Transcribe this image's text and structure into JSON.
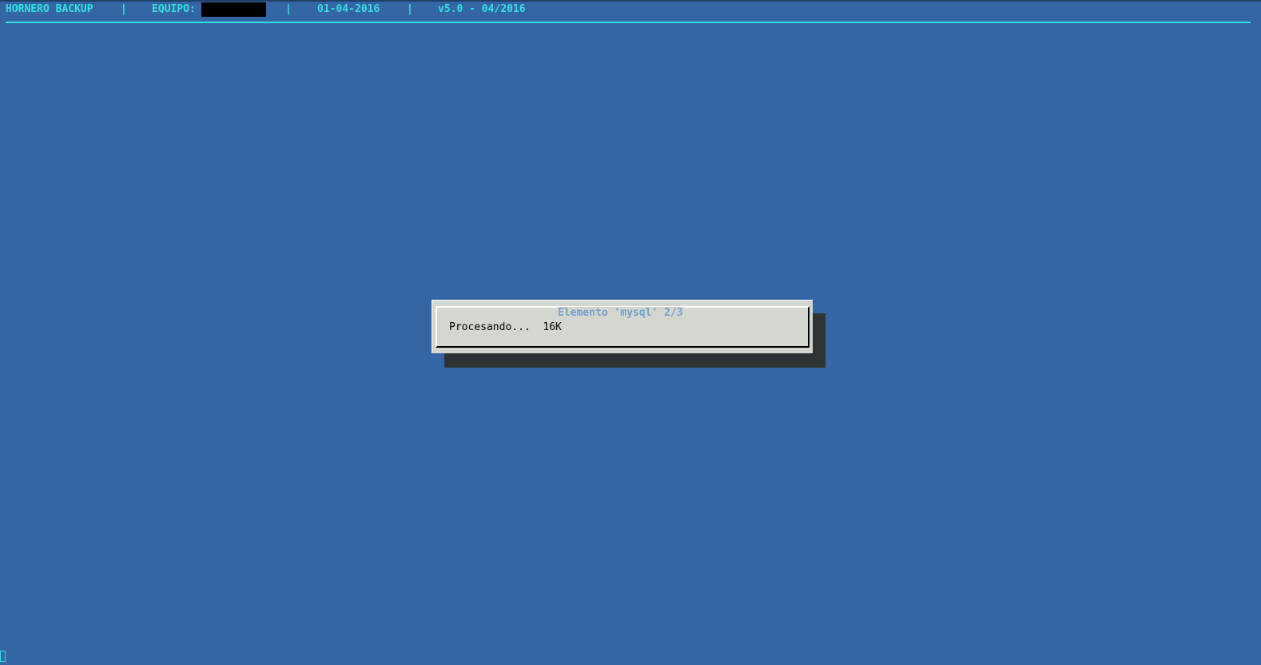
{
  "header": {
    "app_name": "HORNERO BACKUP",
    "separator": "|",
    "equipo_label": "EQUIPO:",
    "date": "01-04-2016",
    "version": "v5.0 - 04/2016"
  },
  "dialog": {
    "title": "Elemento 'mysql' 2/3",
    "message": "Procesando...  16K"
  },
  "colors": {
    "background": "#3465a4",
    "header_text": "#34e2e2",
    "dialog_bg": "#d3d7cf",
    "dialog_title": "#729fcf",
    "shadow": "#2e3436"
  }
}
